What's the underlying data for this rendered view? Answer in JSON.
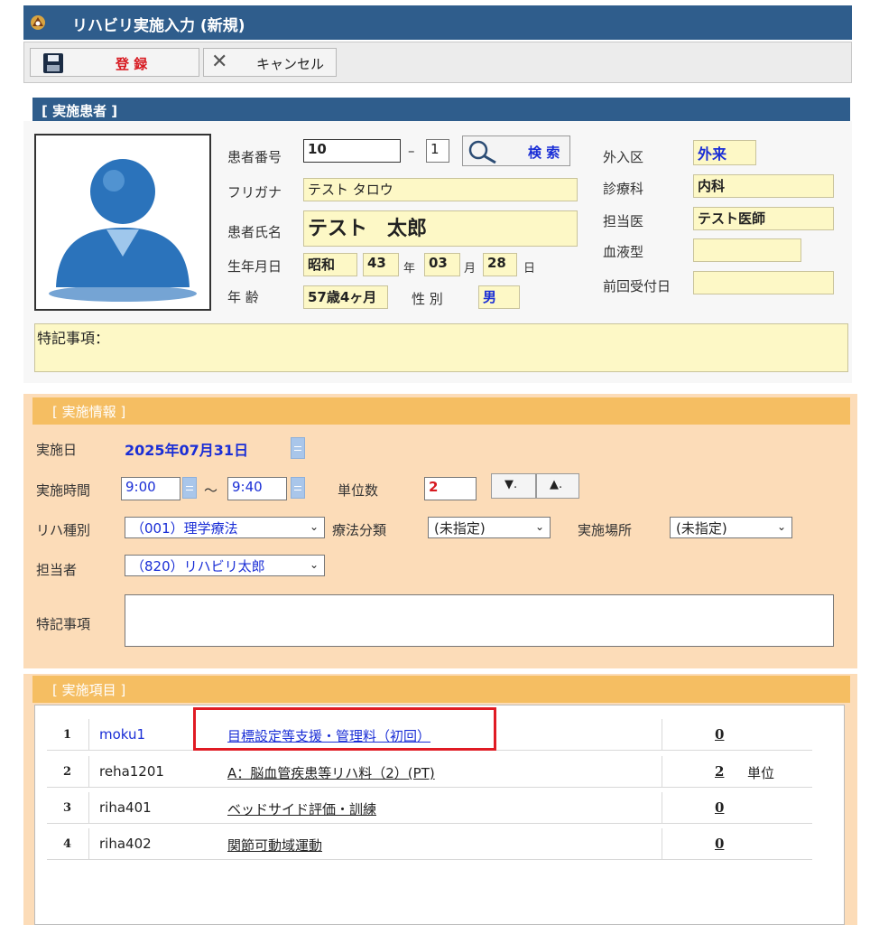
{
  "window": {
    "title": "リハビリ実施入力 (新規)",
    "app_icon": "app-icon"
  },
  "toolbar": {
    "save_label": "登 録",
    "cancel_label": "キャンセル"
  },
  "patient": {
    "header": "[ 実施患者 ]",
    "labels": {
      "number": "患者番号",
      "kana": "フリガナ",
      "name": "患者氏名",
      "birthdate": "生年月日",
      "age": "年 齢",
      "sex": "性 別",
      "inout": "外入区",
      "dept": "診療科",
      "doctor": "担当医",
      "blood": "血液型",
      "last_visit": "前回受付日",
      "notes": "特記事項：",
      "year": "年",
      "month": "月",
      "day": "日"
    },
    "number": "10",
    "dash": "–",
    "branch": "1",
    "search_label": "検 索",
    "kana": "テスト タロウ",
    "name": "テスト　太郎",
    "era": "昭和",
    "year": "43",
    "month": "03",
    "day": "28",
    "age": "57歳4ヶ月",
    "sex": "男",
    "inout": "外来",
    "dept": "内科",
    "doctor": "テスト医師",
    "blood": "",
    "last_visit": ""
  },
  "info": {
    "header": "[ 実施情報 ]",
    "labels": {
      "date": "実施日",
      "time": "実施時間",
      "tilde": "～",
      "units": "単位数",
      "type": "リハ種別",
      "therapy": "療法分類",
      "place": "実施場所",
      "staff": "担当者",
      "notes": "特記事項"
    },
    "date": "2025年07月31日",
    "start": "9:00",
    "end": "9:40",
    "units": "2",
    "down_label": "▼.",
    "up_label": "▲.",
    "type": "（001）理学療法",
    "therapy": "(未指定)",
    "place": "(未指定)",
    "staff": "（820）リハビリ太郎"
  },
  "items": {
    "header": "[ 実施項目 ]",
    "rows": [
      {
        "no": "1",
        "code": "moku1",
        "name": "目標設定等支援・管理料（初回）",
        "qty": "0",
        "unit": ""
      },
      {
        "no": "2",
        "code": "reha1201",
        "name": "A：脳血管疾患等リハ料（2）(PT)",
        "qty": "2",
        "unit": "単位"
      },
      {
        "no": "3",
        "code": "riha401",
        "name": "ベッドサイド評価・訓練",
        "qty": "0",
        "unit": ""
      },
      {
        "no": "4",
        "code": "riha402",
        "name": "関節可動域運動",
        "qty": "0",
        "unit": ""
      }
    ]
  },
  "colors": {
    "brand": "#2f5d8c",
    "section_orange": "#f5be62",
    "panel_peach": "#fcdcb8",
    "field_yellow": "#fdf8c6",
    "highlight": "#e01b24",
    "link_blue": "#1a2ed6"
  }
}
